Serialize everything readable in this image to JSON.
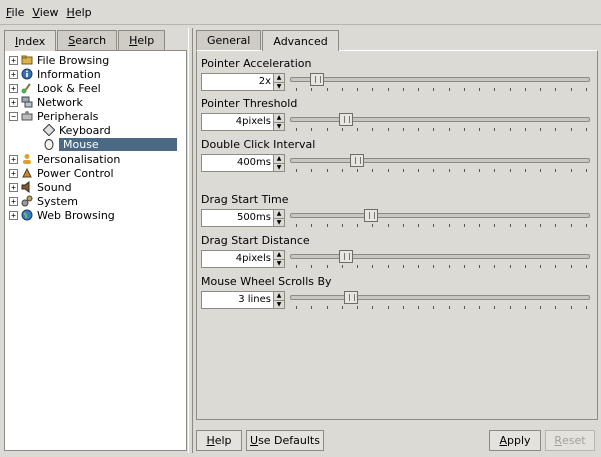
{
  "menubar": {
    "items": [
      {
        "label_ul": "F",
        "label_rest": "ile"
      },
      {
        "label_ul": "V",
        "label_rest": "iew"
      },
      {
        "label_ul": "H",
        "label_rest": "elp"
      }
    ]
  },
  "left_tabs": [
    {
      "label_ul": "I",
      "label_rest": "ndex",
      "active": true
    },
    {
      "label_ul": "S",
      "label_rest": "earch",
      "active": false
    },
    {
      "label_ul": "H",
      "label_rest": "elp",
      "active": false
    }
  ],
  "tree": [
    {
      "label": "File Browsing",
      "icon": "folder-icon"
    },
    {
      "label": "Information",
      "icon": "info-icon"
    },
    {
      "label": "Look & Feel",
      "icon": "brush-icon"
    },
    {
      "label": "Network",
      "icon": "network-icon"
    },
    {
      "label": "Peripherals",
      "icon": "peripherals-icon"
    },
    {
      "label": "Keyboard",
      "icon": "keyboard-icon"
    },
    {
      "label": "Mouse",
      "icon": "mouse-icon",
      "selected": true
    },
    {
      "label": "Personalisation",
      "icon": "person-icon"
    },
    {
      "label": "Power Control",
      "icon": "power-icon"
    },
    {
      "label": "Sound",
      "icon": "speaker-icon"
    },
    {
      "label": "System",
      "icon": "gears-icon"
    },
    {
      "label": "Web Browsing",
      "icon": "globe-icon"
    }
  ],
  "right_tabs": [
    {
      "label": "General",
      "active": false
    },
    {
      "label": "Advanced",
      "active": true
    }
  ],
  "settings": [
    {
      "label": "Pointer Acceleration",
      "value": "2x",
      "level": 0.07
    },
    {
      "label": "Pointer Threshold",
      "value": "4pixels",
      "level": 0.17
    },
    {
      "label": "Double Click Interval",
      "value": "400ms",
      "level": 0.21
    },
    {
      "label": "Drag Start Time",
      "value": "500ms",
      "level": 0.26
    },
    {
      "label": "Drag Start Distance",
      "value": "4pixels",
      "level": 0.17
    },
    {
      "label": "Mouse Wheel Scrolls By",
      "value": "3 lines",
      "level": 0.19
    }
  ],
  "buttons": {
    "help": {
      "ul": "H",
      "rest": "elp"
    },
    "use_defaults": {
      "ul": "U",
      "rest": "se Defaults"
    },
    "apply": {
      "ul": "A",
      "rest": "pply"
    },
    "reset": {
      "ul": "R",
      "rest": "eset"
    }
  },
  "colors": {
    "selection": "#4b6983",
    "background": "#dcdad5"
  }
}
